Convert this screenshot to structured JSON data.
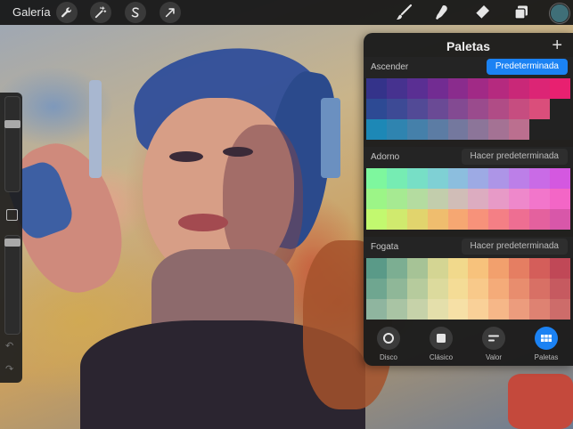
{
  "toolbar": {
    "gallery_label": "Galería",
    "left_icons": [
      "wrench-icon",
      "magic-wand-icon",
      "selection-s-icon",
      "transform-arrow-icon"
    ],
    "right_icons": [
      "brush-icon",
      "smudge-icon",
      "eraser-icon",
      "layers-icon"
    ],
    "current_color": "#3f6f78"
  },
  "panel": {
    "title": "Paletas",
    "add_icon": "+",
    "palettes": [
      {
        "name": "Ascender",
        "button": "Predeterminada",
        "is_default": true,
        "rows": [
          [
            "#34338a",
            "#46328f",
            "#5a2f93",
            "#722c92",
            "#8a2c8d",
            "#a12a86",
            "#b52a7f",
            "#c92878",
            "#dc2575",
            "#e82070"
          ],
          [
            "#2d4a94",
            "#3d4a95",
            "#524a96",
            "#6a4a95",
            "#834a92",
            "#9a4b8d",
            "#b04c86",
            "#c64d80",
            "#da4e7b",
            ""
          ],
          [
            "#1d88b6",
            "#2f84b0",
            "#4580aa",
            "#5c7ca4",
            "#74789e",
            "#8c7599",
            "#a47294",
            "#bb6f8f",
            "",
            ""
          ]
        ]
      },
      {
        "name": "Adorno",
        "button": "Hacer predeterminada",
        "is_default": false,
        "rows": [
          [
            "#7ef79e",
            "#76ecb3",
            "#77dfc6",
            "#7fd0d4",
            "#8cbede",
            "#9daae4",
            "#ad95e7",
            "#bc7fe8",
            "#c96be6",
            "#d458e0"
          ],
          [
            "#9cf587",
            "#a6ea92",
            "#b4dca0",
            "#c2cdac",
            "#d0bdb7",
            "#dcacc0",
            "#e79ac7",
            "#ee88cb",
            "#f276cb",
            "#f366c6"
          ],
          [
            "#c2f96f",
            "#d0ea6e",
            "#e1d46d",
            "#efbd6e",
            "#f6a772",
            "#f7927a",
            "#f47f85",
            "#ee6e92",
            "#e4619e",
            "#d857a9"
          ]
        ]
      },
      {
        "name": "Fogata",
        "button": "Hacer predeterminada",
        "is_default": false,
        "rows": [
          [
            "#5a9a88",
            "#7cae92",
            "#a6c396",
            "#d4d593",
            "#f1d98c",
            "#f7c27c",
            "#f2a06d",
            "#e57e62",
            "#d45e5a",
            "#c04857"
          ],
          [
            "#6fa690",
            "#8fb798",
            "#b6cb9d",
            "#dcda9d",
            "#f4dc96",
            "#f8c98a",
            "#f4ab79",
            "#e88d6e",
            "#d87065",
            "#c65a60"
          ],
          [
            "#8fb59f",
            "#a9c4a4",
            "#c6d2a9",
            "#e4dfab",
            "#f6e0a6",
            "#f9d098",
            "#f6b788",
            "#ec9c7d",
            "#de8272",
            "#cd6c6a"
          ]
        ]
      }
    ],
    "nav": [
      {
        "label": "Disco",
        "icon": "disc-icon",
        "active": false
      },
      {
        "label": "Clásico",
        "icon": "square-icon",
        "active": false
      },
      {
        "label": "Valor",
        "icon": "sliders-icon",
        "active": false
      },
      {
        "label": "Paletas",
        "icon": "grid-icon",
        "active": true
      }
    ]
  },
  "colors": {
    "accent": "#1b82f3",
    "panel_bg": "#1c1c1c",
    "toolbar_bg": "#161616"
  }
}
